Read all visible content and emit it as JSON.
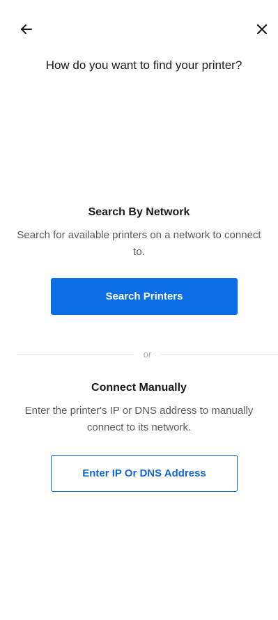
{
  "header": {
    "back_icon": "arrow-left-icon",
    "close_icon": "close-icon",
    "title": "How do you want to find your printer?"
  },
  "network": {
    "title": "Search By Network",
    "description": "Search for available printers on a network to connect to.",
    "button_label": "Search Printers"
  },
  "divider": {
    "label": "or"
  },
  "manual": {
    "title": "Connect Manually",
    "description": "Enter the printer's IP or DNS address to manually connect to its network.",
    "button_label": "Enter IP Or DNS Address"
  },
  "colors": {
    "primary": "#0a6ee6",
    "outline": "#1266d4",
    "text": "#1a1a1a",
    "muted": "#555a60",
    "divider": "#e6e7e9"
  }
}
